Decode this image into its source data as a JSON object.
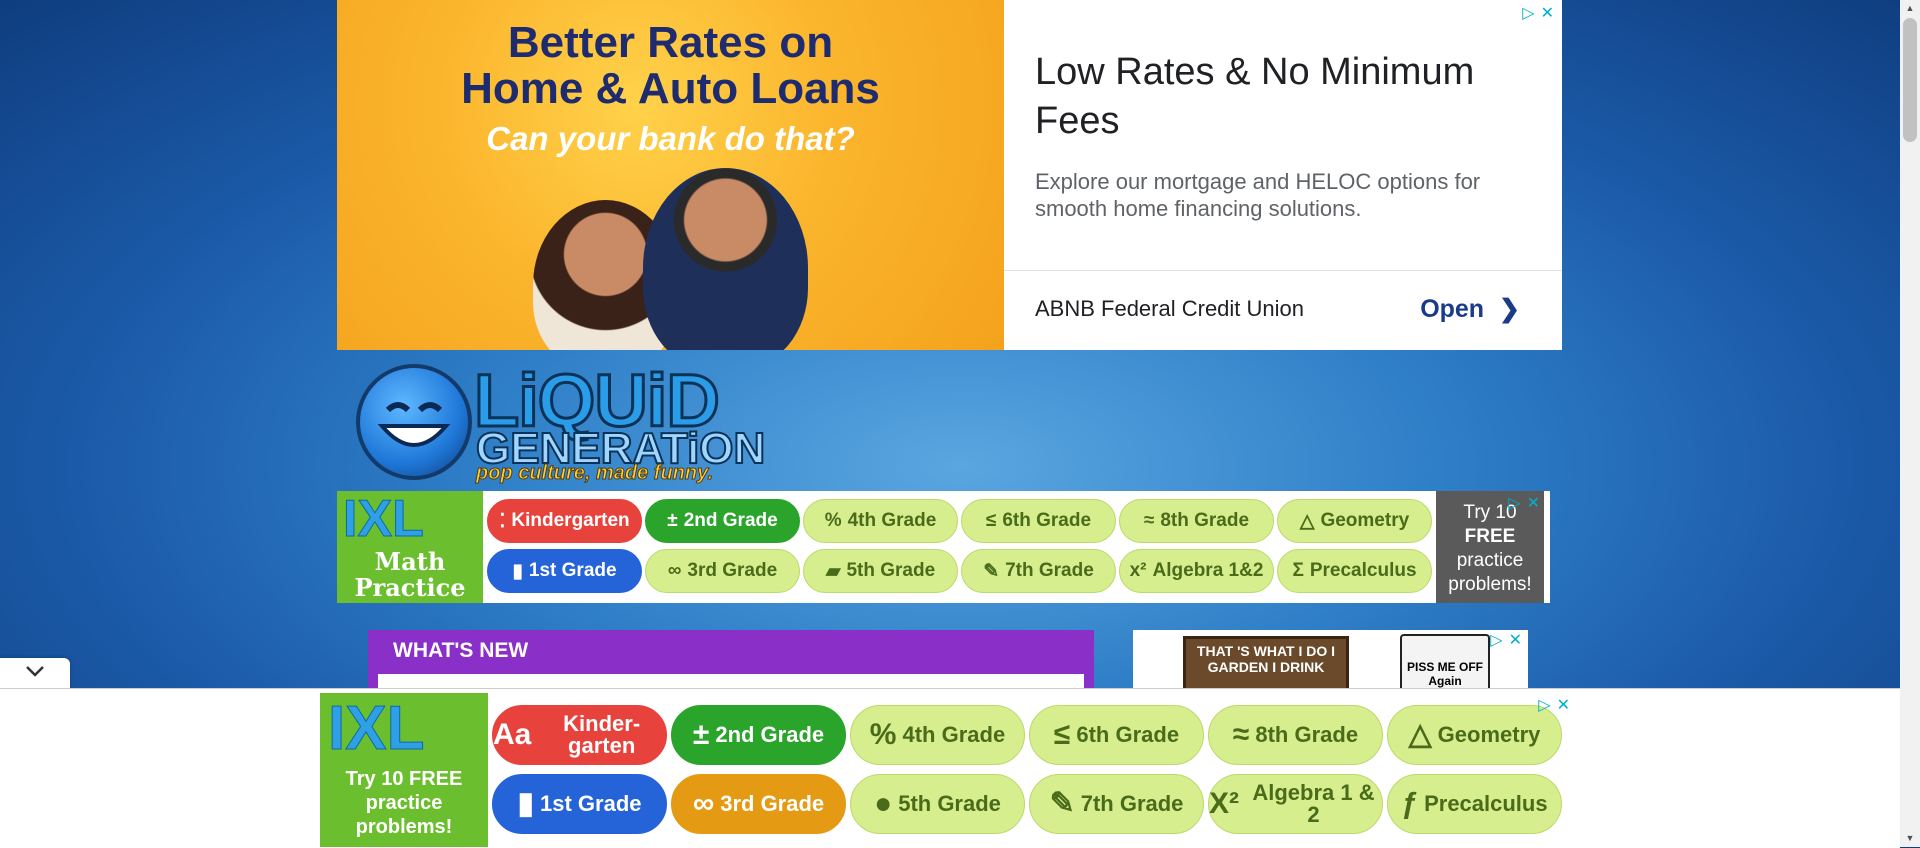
{
  "top_ad": {
    "headline_line1": "Better Rates on",
    "headline_line2": "Home & Auto Loans",
    "tagline": "Can your bank do that?",
    "title": "Low Rates & No Minimum Fees",
    "description": "Explore our mortgage and HELOC options for smooth home financing solutions.",
    "advertiser": "ABNB Federal Credit Union",
    "cta": "Open",
    "adchoices_icon": "▷",
    "close_icon": "✕"
  },
  "logo": {
    "line1": "LiQUiD",
    "line2": "GENERATiON",
    "tagline": "pop culture, made funny."
  },
  "ixl_mid": {
    "brand_sub": "Math Practice",
    "try_line1": "Try 10",
    "try_line2": "FREE",
    "try_line3": "practice",
    "try_line4": "problems!",
    "pills": [
      {
        "icon": "⁚",
        "label": "Kindergarten"
      },
      {
        "icon": "±",
        "label": "2nd Grade"
      },
      {
        "icon": "%",
        "label": "4th Grade"
      },
      {
        "icon": "≤",
        "label": "6th Grade"
      },
      {
        "icon": "≈",
        "label": "8th Grade"
      },
      {
        "icon": "△",
        "label": "Geometry"
      },
      {
        "icon": "▮",
        "label": "1st Grade"
      },
      {
        "icon": "∞",
        "label": "3rd Grade"
      },
      {
        "icon": "▰",
        "label": "5th Grade"
      },
      {
        "icon": "✎",
        "label": "7th Grade"
      },
      {
        "icon": "x²",
        "label": "Algebra 1&2"
      },
      {
        "icon": "Σ",
        "label": "Precalculus"
      }
    ]
  },
  "ixl_bot": {
    "brand_sub": "Try 10 FREE practice problems!",
    "pills": [
      {
        "icon": "Aa",
        "label": "Kinder-garten"
      },
      {
        "icon": "±",
        "label": "2nd Grade"
      },
      {
        "icon": "%",
        "label": "4th Grade"
      },
      {
        "icon": "≤",
        "label": "6th Grade"
      },
      {
        "icon": "≈",
        "label": "8th Grade"
      },
      {
        "icon": "△",
        "label": "Geometry"
      },
      {
        "icon": "▮",
        "label": "1st Grade"
      },
      {
        "icon": "∞",
        "label": "3rd Grade"
      },
      {
        "icon": "●",
        "label": "5th Grade"
      },
      {
        "icon": "✎",
        "label": "7th Grade"
      },
      {
        "icon": "X²",
        "label": "Algebra 1 & 2"
      },
      {
        "icon": "ƒ",
        "label": "Precalculus"
      }
    ]
  },
  "ixl_brand": "IXL",
  "whats_new": {
    "heading": "WHAT'S NEW"
  },
  "side_ad": {
    "sign_text": "THAT 'S WHAT I DO I GARDEN I DRINK",
    "mug_text": "PISS ME OFF Again"
  },
  "colors": {
    "ixl_green": "#6bbf2e",
    "whats_new_purple": "#8b2fc9",
    "ad_cta_blue": "#1a3a8a"
  }
}
